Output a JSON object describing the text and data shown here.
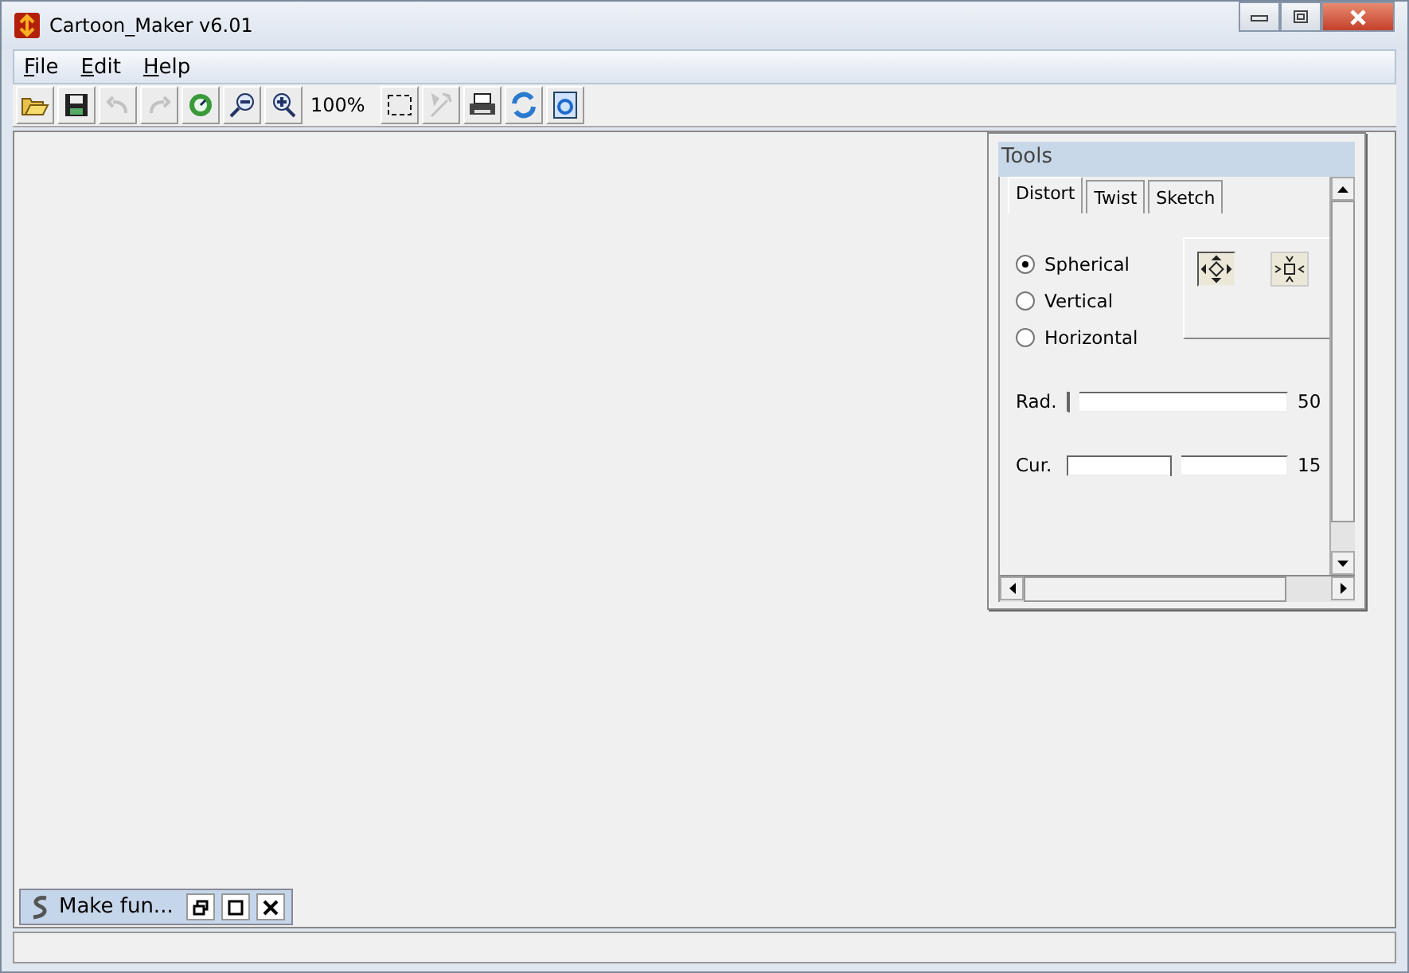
{
  "window": {
    "title": "Cartoon_Maker v6.01"
  },
  "menu": [
    {
      "label": "File"
    },
    {
      "label": "Edit"
    },
    {
      "label": "Help"
    }
  ],
  "toolbar": [
    {
      "kind": "open",
      "disabled": false
    },
    {
      "kind": "save",
      "disabled": false
    },
    {
      "kind": "undo",
      "disabled": true
    },
    {
      "kind": "redo",
      "disabled": true
    },
    {
      "kind": "refresh",
      "disabled": false
    },
    {
      "kind": "zoom-out",
      "disabled": false
    },
    {
      "kind": "zoom-in",
      "disabled": false
    },
    {
      "kind": "zoom-text",
      "text": "100%"
    },
    {
      "kind": "select",
      "disabled": false
    },
    {
      "kind": "wand",
      "disabled": true
    },
    {
      "kind": "print",
      "disabled": false
    },
    {
      "kind": "rotate",
      "disabled": false
    },
    {
      "kind": "browser",
      "disabled": false
    }
  ],
  "tools_panel": {
    "title": "Tools",
    "tabs": [
      {
        "label": "Distort",
        "selected": true
      },
      {
        "label": "Twist",
        "selected": false
      },
      {
        "label": "Sketch",
        "selected": false
      }
    ],
    "options": [
      {
        "label": "Spherical",
        "selected": true
      },
      {
        "label": "Vertical",
        "selected": false
      },
      {
        "label": "Horizontal",
        "selected": false
      }
    ],
    "modes": [
      {
        "kind": "expand",
        "selected": true
      },
      {
        "kind": "shrink",
        "selected": false
      }
    ],
    "sliders": [
      {
        "label": "Rad.",
        "level": 0,
        "reading": "50"
      },
      {
        "label": "Cur.",
        "level": 0.47,
        "reading": "15"
      }
    ]
  },
  "minimized_window": {
    "title": "Make fun..."
  }
}
